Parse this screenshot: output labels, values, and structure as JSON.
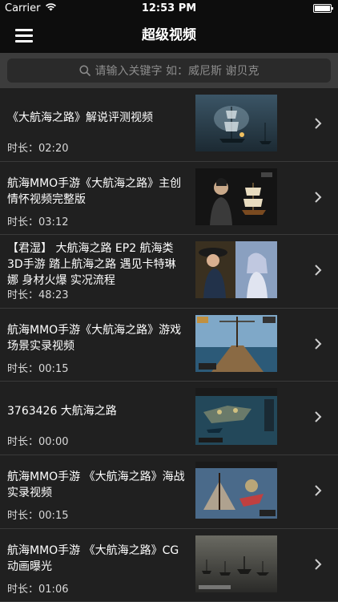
{
  "status": {
    "carrier": "Carrier",
    "time": "12:53 PM"
  },
  "nav": {
    "title": "超级视频",
    "menu_icon": "hamburger-menu-icon"
  },
  "search": {
    "placeholder": "请输入关键字 如：威尼斯 谢贝克",
    "icon": "search-icon"
  },
  "duration_prefix": "时长：",
  "videos": [
    {
      "title": "《大航海之路》解说评测视频",
      "duration": "02:20"
    },
    {
      "title": "航海MMO手游《大航海之路》主创情怀视频完整版",
      "duration": "03:12"
    },
    {
      "title": "【君湿】 大航海之路 EP2 航海类3D手游 踏上航海之路 遇见卡特琳娜 身材火爆 实况流程",
      "duration": "48:23"
    },
    {
      "title": "航海MMO手游《大航海之路》游戏场景实录视频",
      "duration": "00:15"
    },
    {
      "title": "3763426 大航海之路",
      "duration": "00:00"
    },
    {
      "title": "航海MMO手游 《大航海之路》海战实录视频",
      "duration": "00:15"
    },
    {
      "title": "航海MMO手游 《大航海之路》CG动画曝光",
      "duration": "01:06"
    }
  ]
}
